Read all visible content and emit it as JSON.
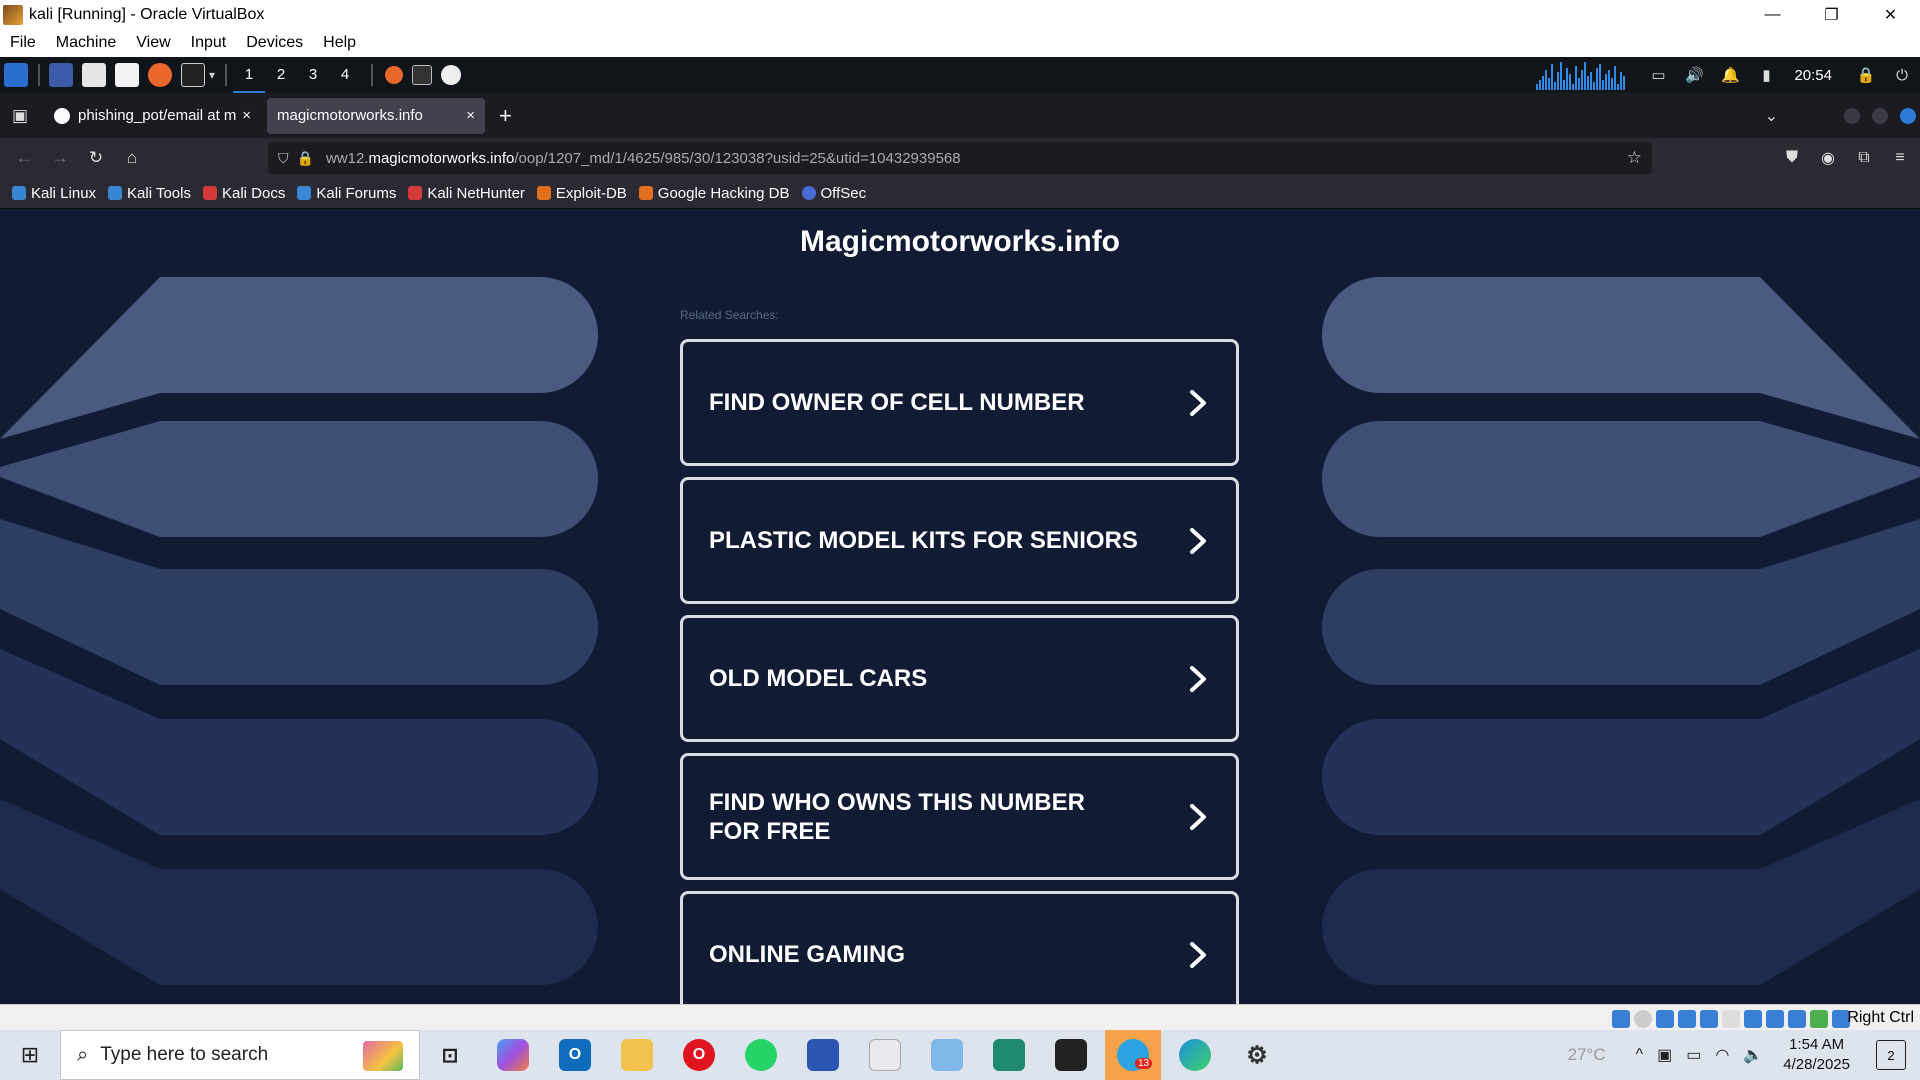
{
  "window": {
    "title": "kali [Running] - Oracle VirtualBox",
    "minimize_glyph": "—",
    "restore_glyph": "❐",
    "close_glyph": "✕"
  },
  "vb_menu": [
    "File",
    "Machine",
    "View",
    "Input",
    "Devices",
    "Help"
  ],
  "kali_panel": {
    "workspaces": [
      "1",
      "2",
      "3",
      "4"
    ],
    "clock": "20:54"
  },
  "tabs": [
    {
      "label": "phishing_pot/email at ma",
      "icon": "github-icon",
      "close": "×"
    },
    {
      "label": "magicmotorworks.info",
      "icon": "",
      "close": "×"
    }
  ],
  "new_tab_glyph": "+",
  "url": {
    "prefix": "ww12.",
    "domain": "magicmotorworks.info",
    "path": "/oop/1207_md/1/4625/985/30/123038?usid=25&utid=10432939568"
  },
  "bookmarks": [
    {
      "label": "Kali Linux",
      "color": "#3a86d4"
    },
    {
      "label": "Kali Tools",
      "color": "#3a86d4"
    },
    {
      "label": "Kali Docs",
      "color": "#d43a3a"
    },
    {
      "label": "Kali Forums",
      "color": "#3a86d4"
    },
    {
      "label": "Kali NetHunter",
      "color": "#d43a3a"
    },
    {
      "label": "Exploit-DB",
      "color": "#e07020"
    },
    {
      "label": "Google Hacking DB",
      "color": "#e07020"
    },
    {
      "label": "OffSec",
      "color": "#4a6ad4"
    }
  ],
  "page": {
    "site_title": "Magicmotorworks.info",
    "related_label": "Related Searches:",
    "links": [
      "FIND OWNER OF CELL NUMBER",
      "PLASTIC MODEL KITS FOR SENIORS",
      "OLD MODEL CARS",
      "FIND WHO OWNS THIS NUMBER FOR FREE",
      "ONLINE GAMING"
    ]
  },
  "vb_status": {
    "host_key": "Right Ctrl"
  },
  "taskbar": {
    "search_placeholder": "Type here to search",
    "weather": "27°C",
    "time": "1:54 AM",
    "date": "4/28/2025",
    "notifications": "2",
    "telegram_badge": "13"
  },
  "colors": {
    "page_bg": "#111b33",
    "accent": "#2e7bd8"
  }
}
